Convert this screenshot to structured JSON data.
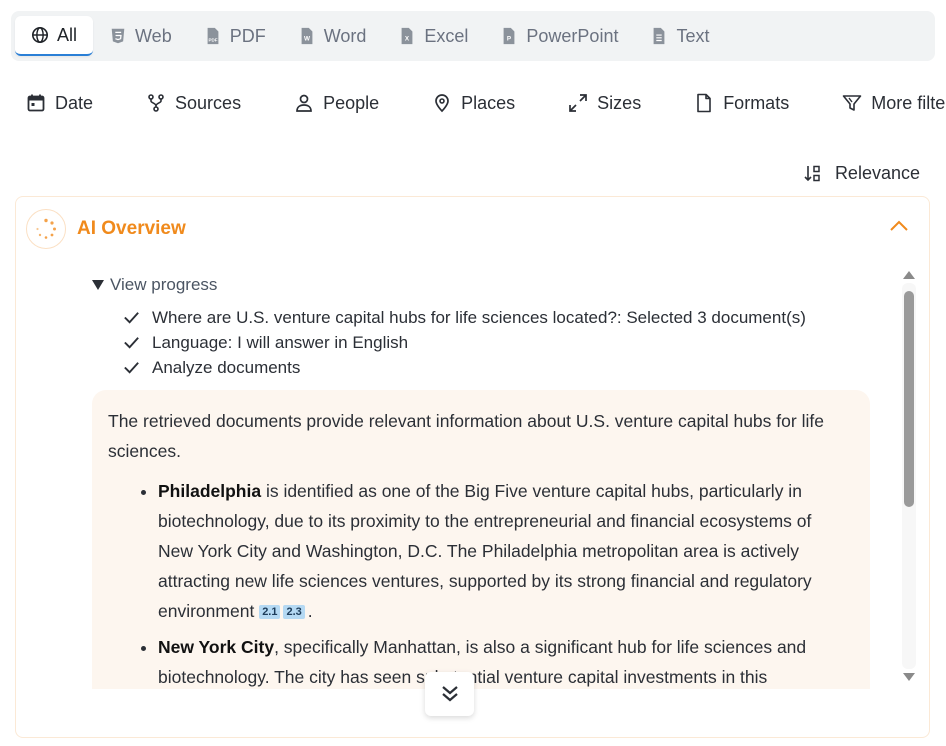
{
  "tabs": [
    {
      "label": "All",
      "icon": "globe-icon",
      "active": true
    },
    {
      "label": "Web",
      "icon": "html5-icon"
    },
    {
      "label": "PDF",
      "icon": "pdf-file-icon"
    },
    {
      "label": "Word",
      "icon": "word-file-icon"
    },
    {
      "label": "Excel",
      "icon": "excel-file-icon"
    },
    {
      "label": "PowerPoint",
      "icon": "powerpoint-file-icon"
    },
    {
      "label": "Text",
      "icon": "text-file-icon"
    }
  ],
  "filters": [
    {
      "label": "Date",
      "icon": "calendar-icon"
    },
    {
      "label": "Sources",
      "icon": "branch-icon"
    },
    {
      "label": "People",
      "icon": "person-icon"
    },
    {
      "label": "Places",
      "icon": "map-pin-icon"
    },
    {
      "label": "Sizes",
      "icon": "expand-arrows-icon"
    },
    {
      "label": "Formats",
      "icon": "file-icon"
    },
    {
      "label": "More filters",
      "icon": "filter-icon"
    }
  ],
  "sort": {
    "label": "Relevance",
    "icon": "sort-icon"
  },
  "overview": {
    "title": "AI Overview",
    "accent_color": "#f08a1c",
    "progress_label": "View progress",
    "progress_steps": [
      "Where are U.S. venture capital hubs for life sciences located?: Selected 3 document(s)",
      "Language: I will answer in English",
      "Analyze documents"
    ],
    "intro": "The retrieved documents provide relevant information about U.S. venture capital hubs for life sciences.",
    "bullets": [
      {
        "bold": "Philadelphia",
        "text": " is identified as one of the Big Five venture capital hubs, particularly in biotechnology, due to its proximity to the entrepreneurial and financial ecosystems of New York City and Washington, D.C. The Philadelphia metropolitan area is actively attracting new life sciences ventures, supported by its strong financial and regulatory environment",
        "citations": [
          "2.1",
          "2.3"
        ],
        "end": "."
      },
      {
        "bold": "New York City",
        "text": ", specifically Manhattan, is also a significant hub for life sciences and biotechnology. The city has seen substantial venture capital investments in this",
        "citations": [],
        "end": ""
      }
    ]
  }
}
